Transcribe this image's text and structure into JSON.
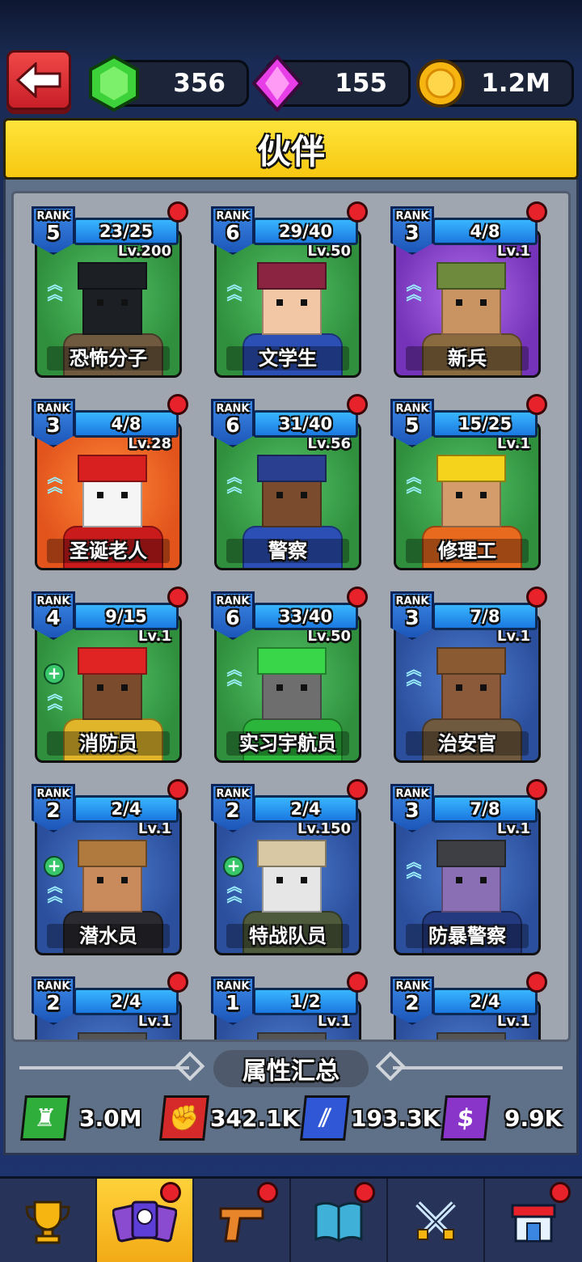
{
  "header": {
    "back_label": "",
    "resources": [
      {
        "icon": "green-gem-icon",
        "value": "356"
      },
      {
        "icon": "pink-crystal-icon",
        "value": "155"
      },
      {
        "icon": "gold-coin-icon",
        "value": "1.2M"
      }
    ]
  },
  "title": "伙伴",
  "rank_label": "RANK",
  "partners": [
    {
      "rank": "5",
      "progress": "23/25",
      "level": "Lv.200",
      "name": "恐怖分子",
      "bg": "green",
      "plus": false,
      "hat": "#1c1f24",
      "face": "#1c1f24",
      "body": "#6f5a3f"
    },
    {
      "rank": "6",
      "progress": "29/40",
      "level": "Lv.50",
      "name": "文学生",
      "bg": "green",
      "plus": false,
      "hat": "#8a2440",
      "face": "#f1c7a5",
      "body": "#2b4fb5"
    },
    {
      "rank": "3",
      "progress": "4/8",
      "level": "Lv.1",
      "name": "新兵",
      "bg": "purple",
      "plus": false,
      "hat": "#6e8a3c",
      "face": "#c99461",
      "body": "#8a6b40"
    },
    {
      "rank": "3",
      "progress": "4/8",
      "level": "Lv.28",
      "name": "圣诞老人",
      "bg": "orange",
      "plus": false,
      "hat": "#d92020",
      "face": "#f5f5f5",
      "body": "#c91b1b"
    },
    {
      "rank": "6",
      "progress": "31/40",
      "level": "Lv.56",
      "name": "警察",
      "bg": "green",
      "plus": false,
      "hat": "#2a3f8f",
      "face": "#7a4b2c",
      "body": "#2b4fb5"
    },
    {
      "rank": "5",
      "progress": "15/25",
      "level": "Lv.1",
      "name": "修理工",
      "bg": "green",
      "plus": false,
      "hat": "#f5d21c",
      "face": "#d59c6b",
      "body": "#e86a1e"
    },
    {
      "rank": "4",
      "progress": "9/15",
      "level": "Lv.1",
      "name": "消防员",
      "bg": "green",
      "plus": true,
      "hat": "#e02424",
      "face": "#7a4b2c",
      "body": "#e0b52a"
    },
    {
      "rank": "6",
      "progress": "33/40",
      "level": "Lv.50",
      "name": "实习宇航员",
      "bg": "green",
      "plus": false,
      "hat": "#3ad64a",
      "face": "#6e6e6e",
      "body": "#2bb53b"
    },
    {
      "rank": "3",
      "progress": "7/8",
      "level": "Lv.1",
      "name": "治安官",
      "bg": "blue",
      "plus": false,
      "hat": "#8a5a32",
      "face": "#8a5a3a",
      "body": "#6f5a3f"
    },
    {
      "rank": "2",
      "progress": "2/4",
      "level": "Lv.1",
      "name": "潜水员",
      "bg": "blue",
      "plus": true,
      "hat": "#b07a3e",
      "face": "#c98a5c",
      "body": "#2a2a30"
    },
    {
      "rank": "2",
      "progress": "2/4",
      "level": "Lv.150",
      "name": "特战队员",
      "bg": "blue",
      "plus": true,
      "hat": "#d8c9a4",
      "face": "#e6e6e6",
      "body": "#4d5a3c"
    },
    {
      "rank": "3",
      "progress": "7/8",
      "level": "Lv.1",
      "name": "防暴警察",
      "bg": "blue",
      "plus": false,
      "hat": "#3d3f44",
      "face": "#8a6fb5",
      "body": "#243a80"
    },
    {
      "rank": "2",
      "progress": "2/4",
      "level": "Lv.1",
      "name": "",
      "bg": "blue",
      "plus": false,
      "hat": "#555",
      "face": "#999",
      "body": "#333"
    },
    {
      "rank": "1",
      "progress": "1/2",
      "level": "Lv.1",
      "name": "",
      "bg": "blue",
      "plus": false,
      "hat": "#555",
      "face": "#999",
      "body": "#333"
    },
    {
      "rank": "2",
      "progress": "2/4",
      "level": "Lv.1",
      "name": "",
      "bg": "blue",
      "plus": false,
      "hat": "#555",
      "face": "#999",
      "body": "#333"
    }
  ],
  "summary": {
    "title": "属性汇总",
    "stats": [
      {
        "icon": "tower-icon",
        "value": "3.0M",
        "color": "#2fae3c"
      },
      {
        "icon": "fist-icon",
        "value": "342.1K",
        "color": "#d62a2a"
      },
      {
        "icon": "ammo-icon",
        "value": "193.3K",
        "color": "#3057d6"
      },
      {
        "icon": "money-bag-icon",
        "value": "9.9K",
        "color": "#8a35c9"
      }
    ]
  },
  "nav": [
    {
      "name": "nav-trophy",
      "icon": "trophy-icon",
      "active": false,
      "dot": false
    },
    {
      "name": "nav-partners",
      "icon": "partner-cards-icon",
      "active": true,
      "dot": true
    },
    {
      "name": "nav-weapons",
      "icon": "pistol-icon",
      "active": false,
      "dot": true
    },
    {
      "name": "nav-codex",
      "icon": "book-icon",
      "active": false,
      "dot": true
    },
    {
      "name": "nav-battle",
      "icon": "crossed-swords-icon",
      "active": false,
      "dot": false
    },
    {
      "name": "nav-shop",
      "icon": "shop-icon",
      "active": false,
      "dot": true
    }
  ]
}
